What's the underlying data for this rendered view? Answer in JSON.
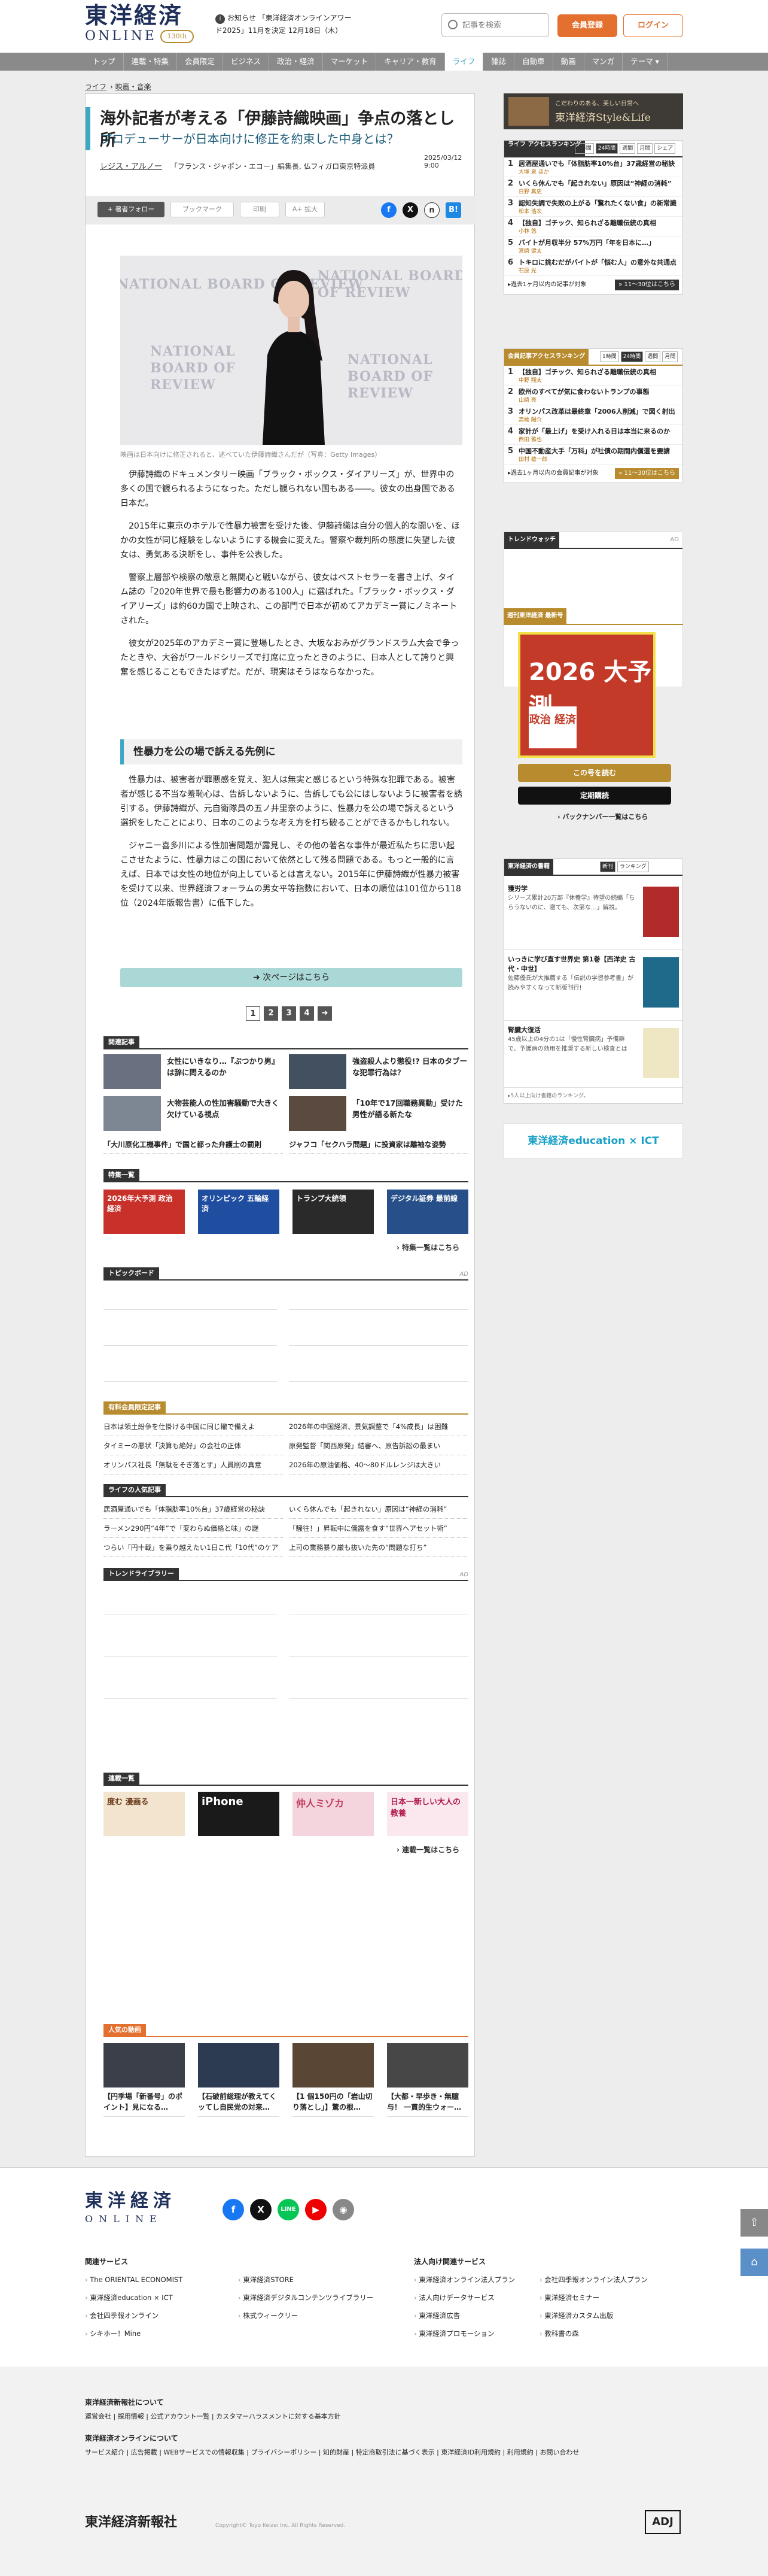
{
  "header": {
    "logo_main": "東洋経済",
    "logo_sub": "ONLINE",
    "logo_badge": "130th",
    "notice_label": "お知らせ",
    "notice_text": "「東洋経済オンラインアワード2025」11月を決定 12月18日（木）",
    "search_placeholder": "記事を検索",
    "register_label": "会員登録",
    "login_label": "ログイン"
  },
  "nav": [
    "トップ",
    "連載・特集",
    "会員限定",
    "ビジネス",
    "政治・経済",
    "マーケット",
    "キャリア・教育",
    "ライフ",
    "雑誌",
    "自動車",
    "動画",
    "マンガ",
    "テーマ ▾"
  ],
  "nav_active": "ライフ",
  "breadcrumb": [
    "ライフ",
    "映画・音楽"
  ],
  "article": {
    "title": "海外記者が考える「伊藤詩織映画」争点の落とし所",
    "subtitle": "プロデューサーが日本向けに修正を約束した中身とは？",
    "author_name": "レジス・アルノー",
    "author_role": "「フランス・ジャポン・エコー」編集長, 仏フィガロ東京特派員",
    "date": "2025/03/12 9:00",
    "follow_label": "+ 著者フォロー",
    "bookmark_label": "ブックマーク",
    "print_label": "印刷",
    "font_label": "A+ 拡大",
    "photo_watermark": "NATIONAL BOARD OF REVIEW",
    "caption": "映画は日本向けに修正されると、述べていた伊藤詩織さんだが（写真：Getty Images）",
    "paragraphs_1": [
      "伊藤詩織のドキュメンタリー映画「ブラック・ボックス・ダイアリーズ」が、世界中の多くの国で観られるようになった。ただし観られない国もある――。彼女の出身国である日本だ。",
      "2015年に東京のホテルで性暴力被害を受けた後、伊藤詩織は自分の個人的な闘いを、ほかの女性が同じ経験をしないようにする機会に変えた。警察や裁判所の態度に失望した彼女は、勇気ある決断をし、事件を公表した。",
      "警察上層部や検察の敵意と無関心と戦いながら、彼女はベストセラーを書き上げ、タイム誌の「2020年世界で最も影響力のある100人」に選ばれた。「ブラック・ボックス・ダイアリーズ」は約60カ国で上映され、この部門で日本が初めてアカデミー賞にノミネートされた。",
      "彼女が2025年のアカデミー賞に登場したとき、大坂なおみがグランドスラム大会で争ったときや、大谷がワールドシリーズで打席に立ったときのように、日本人として誇りと興奮を感じることもできたはずだ。だが、現実はそうはならなかった。"
    ],
    "h2": "性暴力を公の場で訴える先例に",
    "paragraphs_2": [
      "性暴力は、被害者が罪悪感を覚え、犯人は無実と感じるという特殊な犯罪である。被害者が感じる不当な羞恥心は、告訴しないように、告訴しても公にはしないように被害者を誘引する。伊藤詩織が、元自衛隊員の五ノ井里奈のように、性暴力を公の場で訴えるという選択をしたことにより、日本のこのような考え方を打ち破ることができるかもしれない。",
      "ジャニー喜多川による性加害問題が露見し、その他の著名な事件が最近私たちに思い起こさせたように、性暴力はこの国において依然として残る問題である。もっと一般的に言えば、日本では女性の地位が向上しているとは言えない。2015年に伊藤詩織が性暴力被害を受けて以来、世界経済フォーラムの男女平等指数において、日本の順位は101位から118位（2024年版報告書）に低下した。"
    ],
    "next_label": "➜ 次ページはこちら",
    "pages": [
      "1",
      "2",
      "3",
      "4",
      "➜"
    ]
  },
  "related": {
    "heading": "関連記事",
    "items": [
      "女性にいきなり…『ぶつかり男』は辞に問えるのか",
      "強盗殺人より懲役!? 日本のタブーな犯罪行為は？",
      "大物芸能人の性加害騒動で大きく欠けている視点",
      "「10年で17回職務異動」受けた男性が語る新たな"
    ],
    "lines": [
      "「大川原化工機事件」で国と都った弁護士の罰則",
      "ジャフコ「セクハラ問題」に投資家は離袖な姿勢"
    ]
  },
  "features": {
    "heading": "特集一覧",
    "items": [
      "2026年大予測 政治 経済",
      "オリンピック 五輪経済",
      "トランプ大統領",
      "デジタル証券 最前線"
    ],
    "more_label": "› 特集一覧はこちら"
  },
  "topic_board": {
    "heading": "トピックボード",
    "ad": "AD"
  },
  "members": {
    "heading": "有料会員限定記事",
    "lines": [
      "日本は領土紛争を仕掛ける中国に同じ轍で備えよ",
      "2026年の中国経済、景気調整で「4%成長」は困難",
      "タイミーの悪状「決算も絶好」の会社の正体",
      "原発監督「関西原発」結審へ、原告訴訟の最まい",
      "オリンパス社長「無駄をそぎ落とす」人員削の真意",
      "2026年の原油価格、40〜80ドルレンジは大きい"
    ]
  },
  "life_popular": {
    "heading": "ライフの人気記事",
    "lines": [
      "居酒屋通いでも「体脂肪率10%台」37歳経営の秘訣",
      "いくら休んでも「起きれない」原因は“神経の消耗”",
      "ラーメン290円“4年”で「変わらぬ価格と味」の謎",
      "「騒往！」昇転中に儀露を食す“世界ヘアセット術”",
      "つらい「円十載」を乗り越えたい1日こ代「10代”のケア",
      "上司の業務暴り厳も抜いた先の“問題な打ち”"
    ]
  },
  "trend_library": {
    "heading": "トレンドライブラリー",
    "ad": "AD"
  },
  "series": {
    "heading": "連載一覧",
    "items": [
      "度む 漫画る",
      "iPhone",
      "仲人ミゾカ",
      "日本一新しい大人の教養"
    ],
    "more_label": "› 連載一覧はこちら"
  },
  "popular": {
    "heading": "人気の動画",
    "items": [
      "【円季場「新番号」のポイント】見になる…",
      "【石破前総理が教えてくッてし自民党の対来…",
      "【1 個150円の「岩山切り落とし」】驚の根…",
      "【大都・早歩き・無臆与！ 一貫的生ウォー…"
    ]
  },
  "sidebar": {
    "ad_style_top": "こだわりのある、美しい日常へ",
    "ad_style_main": "東洋経済Style&Life",
    "life_rank": {
      "label": "ライフ アクセスランキング",
      "tabs": [
        "1時間",
        "24時間",
        "週間",
        "月間",
        "シェア"
      ],
      "items": [
        {
          "t": "居酒屋通いでも「体脂肪率10%台」37歳経営の秘訣",
          "a": "大塚 泉 ほか"
        },
        {
          "t": "いくら休んでも「起きれない」原因は“神経の消耗”",
          "a": "日野 真史"
        },
        {
          "t": "認知失調で失敗の上がる「驚れたくない食」の新常識",
          "a": "松本 浩次"
        },
        {
          "t": "【独自】ゴチック、知られざる離職伝統の真相",
          "a": "小林 悠"
        },
        {
          "t": "バイトが月収半分 57%万円「年を日本に…」",
          "a": "宮崎 健太"
        },
        {
          "t": "トキロに挑むだがバイトが「悩む人」の意外な共通点",
          "a": "石原 光"
        }
      ],
      "foot": "▸過去1ヶ月以内の記事が対象",
      "go": "» 11〜30位はこちら"
    },
    "member_rank": {
      "label": "会員記事アクセスランキング",
      "tabs": [
        "1時間",
        "24時間",
        "週間",
        "月間"
      ],
      "items": [
        {
          "t": "【独自】ゴチック、知られざる離職伝統の真相",
          "a": "中野 翔太"
        },
        {
          "t": "欧州のすべてが気に食わないトランプの事態",
          "a": "山崎 亮"
        },
        {
          "t": "オリンパス改革は最終章「2006人削減」で図く射出",
          "a": "高橋 陽介"
        },
        {
          "t": "家計が「最上げ」を受け入れる日は本当に来るのか",
          "a": "西田 雅也"
        },
        {
          "t": "中国不動産大手「万科」が社債の期間内償還を要請",
          "a": "田村 雄一郎"
        }
      ],
      "foot": "▸過去1ヶ月以内の会員記事が対象",
      "go": "» 11〜30位はこちら"
    },
    "trend_watch": {
      "heading": "トレンドウォッチ",
      "ad": "AD"
    },
    "magazine": {
      "heading": "週刊東洋経済 最新号",
      "cover_title": "2026 大予測",
      "cover_sub": "政治 経済",
      "buy_label": "この号を読む",
      "sub_label": "定期購読",
      "back_label": "› バックナンバー一覧はこちら"
    },
    "books": {
      "heading": "東洋経済の書籍",
      "tabs": [
        "新刊",
        "ランキング"
      ],
      "items": [
        {
          "t": "獲労学",
          "d": "シリーズ累計20万部『休養学』待望の続編「ちらうないのに、寝ても、次第な…」解説。"
        },
        {
          "t": "いっきに学び直す世界史 第1巻【西洋史 古代・中世】",
          "d": "佐藤優氏が大推薦する「伝説の学習参考書」が読みやすくなって新版刊行!"
        },
        {
          "t": "腎臓大復活",
          "d": "45歳以上の4分の1は「慢性腎臓病」予備群で、予護病の効用を推奨する新しい検査とは"
        }
      ],
      "foot": "▸5人以上向け書籍のランキング。"
    },
    "ad_edu": "東洋経済education × ICT"
  },
  "footer": {
    "logo": "東洋経済",
    "logo_sub": "ONLINE",
    "sns": [
      "facebook-icon",
      "x-icon",
      "line-icon",
      "youtube-icon",
      "rss-icon"
    ],
    "col1_h": "関連サービス",
    "col1": [
      "The ORIENTAL ECONOMIST",
      "東洋経済education × ICT",
      "会社四季報オンライン",
      "シキホー！Mine"
    ],
    "col2": [
      "東洋経済STORE",
      "東洋経済デジタルコンテンツライブラリー",
      "株式ウィークリー"
    ],
    "col3_h": "法人向け関連サービス",
    "col3": [
      "東洋経済オンライン法人プラン",
      "法人向けデータサービス",
      "東洋経済広告",
      "東洋経済プロモーション"
    ],
    "col4": [
      "会社四季報オンライン法人プラン",
      "東洋経済セミナー",
      "東洋経済カスタム出版",
      "教科書の森"
    ],
    "co_h": "東洋経済新報社について",
    "co_links": "運営会社 | 採用情報 | 公式アカウント一覧 | カスタマーハラスメントに対する基本方針",
    "ol_h": "東洋経済オンラインについて",
    "ol_links": "サービス紹介 | 広告掲載 | WEBサービスでの情報収集 | プライバシーポリシー | 知的財産 | 特定商取引法に基づく表示 | 東洋経済ID利用規約 | 利用規約 | お問い合わせ",
    "company": "東洋経済新報社",
    "copyright": "Copyright© Toyo Keizai Inc. All Rights Reserved.",
    "badge": "ADJ"
  }
}
